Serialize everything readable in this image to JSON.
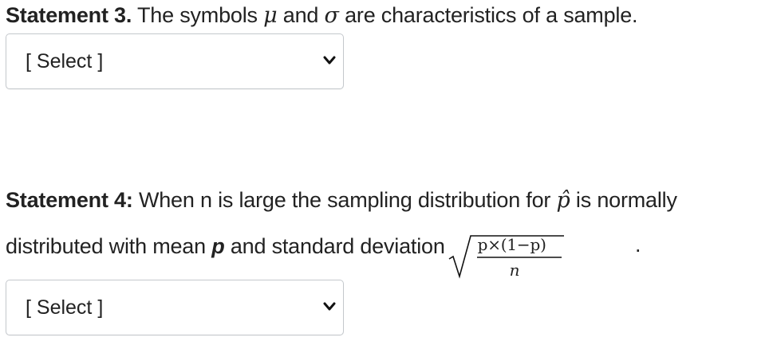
{
  "statement3": {
    "label": "Statement 3.",
    "text_before": " The symbols ",
    "symbol_mu": "μ",
    "text_and": " and ",
    "symbol_sigma": "σ",
    "text_after": " are characteristics of a sample."
  },
  "select3": {
    "value": "[ Select ]",
    "icon": "chevron-down-icon"
  },
  "statement4": {
    "label": "Statement 4",
    "colon": ":",
    "line1_before": " When n is large the sampling distribution for ",
    "p_hat": "p̂",
    "line1_after": " is normally",
    "line2_before": "distributed with mean ",
    "mean_symbol": "p",
    "line2_after": " and standard deviation",
    "formula_numerator": "p×(1−p)",
    "formula_denominator": "n",
    "period": "."
  },
  "select4": {
    "value": "[ Select ]",
    "icon": "chevron-down-icon"
  },
  "colors": {
    "text": "#222222",
    "border": "#c4c8cc"
  }
}
